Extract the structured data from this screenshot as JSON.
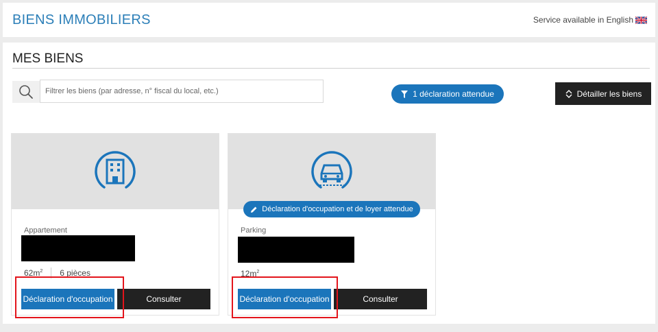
{
  "header": {
    "title": "BIENS IMMOBILIERS",
    "lang_text": "Service available in English",
    "flag_icon": "uk-flag-icon"
  },
  "main": {
    "section_title": "MES BIENS",
    "search": {
      "placeholder": "Filtrer les biens (par adresse, n° fiscal du local, etc.)",
      "value": "",
      "icon": "search-icon"
    },
    "filter_pill": {
      "label": "1 déclaration attendue",
      "icon": "filter-icon"
    },
    "detail_button": {
      "label": "Détailler les biens",
      "icon": "expand-collapse-icon"
    }
  },
  "cards": [
    {
      "type": "Appartement",
      "icon": "building-icon",
      "area": "62m",
      "area_sup": "2",
      "rooms": "6 pièces",
      "declare_label": "Déclaration d'occupation",
      "view_label": "Consulter"
    },
    {
      "type": "Parking",
      "icon": "car-icon",
      "badge": "Déclaration d'occupation et de loyer attendue",
      "badge_icon": "pencil-icon",
      "area": "12m",
      "area_sup": "2",
      "declare_label": "Déclaration d'occupation",
      "view_label": "Consulter"
    }
  ],
  "colors": {
    "accent_blue": "#1b75bb",
    "title_blue": "#2c7fb8",
    "dark_button": "#222222",
    "highlight_red": "#e3141b"
  }
}
